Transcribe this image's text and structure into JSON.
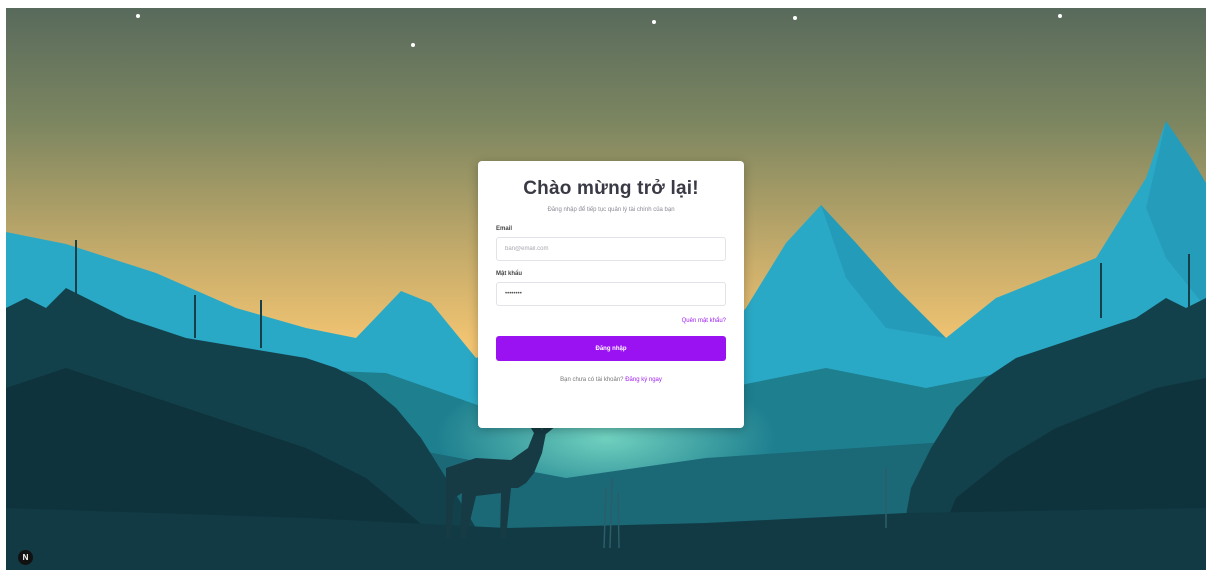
{
  "login": {
    "title": "Chào mừng trở lại!",
    "subtitle": "Đăng nhập để tiếp tục quản lý tài chính của bạn",
    "email_label": "Email",
    "email_placeholder": "ban@email.com",
    "password_label": "Mật khẩu",
    "password_value": "••••••••",
    "forgot_link": "Quên mật khẩu?",
    "submit_label": "Đăng nhập",
    "signup_prompt": "Bạn chưa có tài khoản?",
    "signup_link": "Đăng ký ngay"
  },
  "corner_button": {
    "label": "N"
  },
  "colors": {
    "accent": "#9b12f2",
    "link": "#a020f0",
    "sky_top": "#5c6e5c",
    "sky_bottom": "#f1c271",
    "mountain": "#27a6c4",
    "forest": "#10363f"
  },
  "icons": [
    "next-logo-icon"
  ]
}
